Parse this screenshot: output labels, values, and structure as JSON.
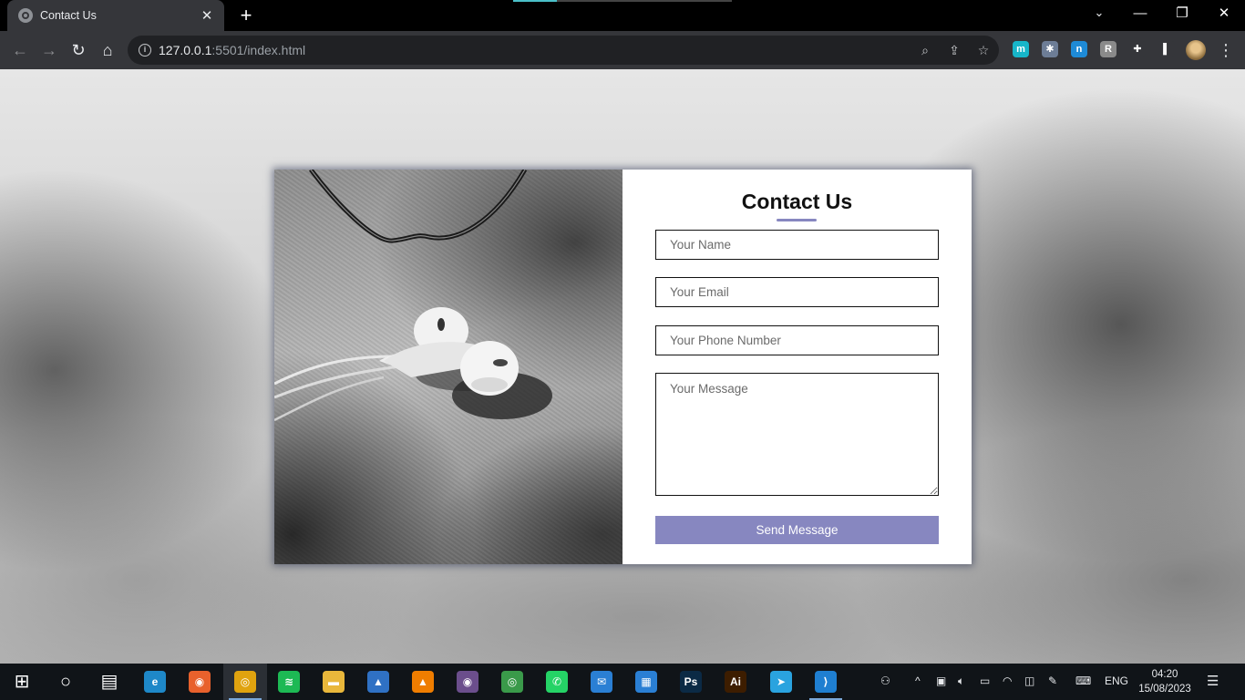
{
  "browser": {
    "tab_title": "Contact Us",
    "tab_close": "✕",
    "new_tab": "+",
    "tab_search": "⌄",
    "window_controls": {
      "minimize": "—",
      "restore": "❐",
      "close": "✕"
    },
    "nav": {
      "back": "←",
      "forward": "→",
      "reload": "↻",
      "home": "⌂"
    },
    "url_host": "127.0.0.1",
    "url_rest": ":5501/index.html",
    "omnibox_icons": [
      "zoom-icon",
      "share-icon",
      "star-icon"
    ],
    "extensions": [
      {
        "name": "metamask-extension-icon",
        "glyph": "m",
        "color": "#17b6c9"
      },
      {
        "name": "puzzle-extension-icon",
        "glyph": "✱",
        "color": "#6d7d96"
      },
      {
        "name": "n-extension-icon",
        "glyph": "n",
        "color": "#1e8ad6"
      },
      {
        "name": "r-extension-icon",
        "glyph": "R",
        "color": "#8a8a8a"
      },
      {
        "name": "extensions-icon",
        "glyph": "✚",
        "color": "#35363a"
      },
      {
        "name": "side-panel-icon",
        "glyph": "▌",
        "color": "#35363a"
      }
    ],
    "menu": "⋮"
  },
  "page": {
    "heading": "Contact Us",
    "accent_color": "#8787c0",
    "fields": {
      "name_placeholder": "Your Name",
      "email_placeholder": "Your Email",
      "phone_placeholder": "Your Phone Number",
      "message_placeholder": "Your Message"
    },
    "submit_label": "Send Message"
  },
  "taskbar": {
    "apps": [
      {
        "name": "start-icon",
        "glyph": "⊞",
        "color": "transparent"
      },
      {
        "name": "search-icon",
        "glyph": "○",
        "color": "transparent"
      },
      {
        "name": "task-view-icon",
        "glyph": "▤",
        "color": "transparent"
      },
      {
        "name": "edge-icon",
        "glyph": "e",
        "color": "#1e88c8"
      },
      {
        "name": "firefox-icon",
        "glyph": "◉",
        "color": "#e8612c"
      },
      {
        "name": "chrome-icon",
        "glyph": "◎",
        "color": "#e0a30f"
      },
      {
        "name": "spotify-icon",
        "glyph": "≋",
        "color": "#1db954"
      },
      {
        "name": "file-explorer-icon",
        "glyph": "▬",
        "color": "#e9b73b"
      },
      {
        "name": "photos-icon",
        "glyph": "▲",
        "color": "#2f71c4"
      },
      {
        "name": "vlc-icon",
        "glyph": "▲",
        "color": "#ef7d00"
      },
      {
        "name": "groove-icon",
        "glyph": "◉",
        "color": "#6b4e8c"
      },
      {
        "name": "chrome-profile-icon",
        "glyph": "◎",
        "color": "#3a9a4a"
      },
      {
        "name": "whatsapp-icon",
        "glyph": "✆",
        "color": "#25d366"
      },
      {
        "name": "mail-icon",
        "glyph": "✉",
        "color": "#2a7fd4"
      },
      {
        "name": "store-icon",
        "glyph": "▦",
        "color": "#2a7fd4"
      },
      {
        "name": "photoshop-icon",
        "glyph": "Ps",
        "color": "#0b2a45"
      },
      {
        "name": "illustrator-icon",
        "glyph": "Ai",
        "color": "#3d1d00"
      },
      {
        "name": "telegram-icon",
        "glyph": "➤",
        "color": "#2aa3df"
      },
      {
        "name": "vscode-icon",
        "glyph": "⟩",
        "color": "#1f7fd1"
      }
    ],
    "language": "ENG",
    "time": "04:20",
    "date": "15/08/2023"
  }
}
